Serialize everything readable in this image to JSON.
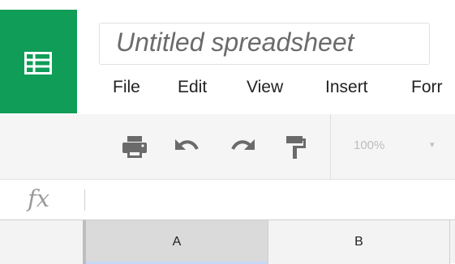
{
  "app": {
    "logo_icon": "sheets-grid-icon",
    "brand_color": "#0f9d58"
  },
  "document": {
    "title": "Untitled spreadsheet"
  },
  "menu": {
    "items": [
      {
        "label": "File"
      },
      {
        "label": "Edit"
      },
      {
        "label": "View"
      },
      {
        "label": "Insert"
      },
      {
        "label": "Forr"
      }
    ]
  },
  "toolbar": {
    "buttons": [
      {
        "icon": "print-icon"
      },
      {
        "icon": "undo-icon"
      },
      {
        "icon": "redo-icon"
      },
      {
        "icon": "paint-format-icon"
      }
    ],
    "zoom": "100%",
    "zoom_caret": "▾"
  },
  "formula_bar": {
    "label": "fx",
    "value": ""
  },
  "grid": {
    "columns": [
      {
        "label": "A",
        "selected": true
      },
      {
        "label": "B",
        "selected": false
      }
    ]
  }
}
